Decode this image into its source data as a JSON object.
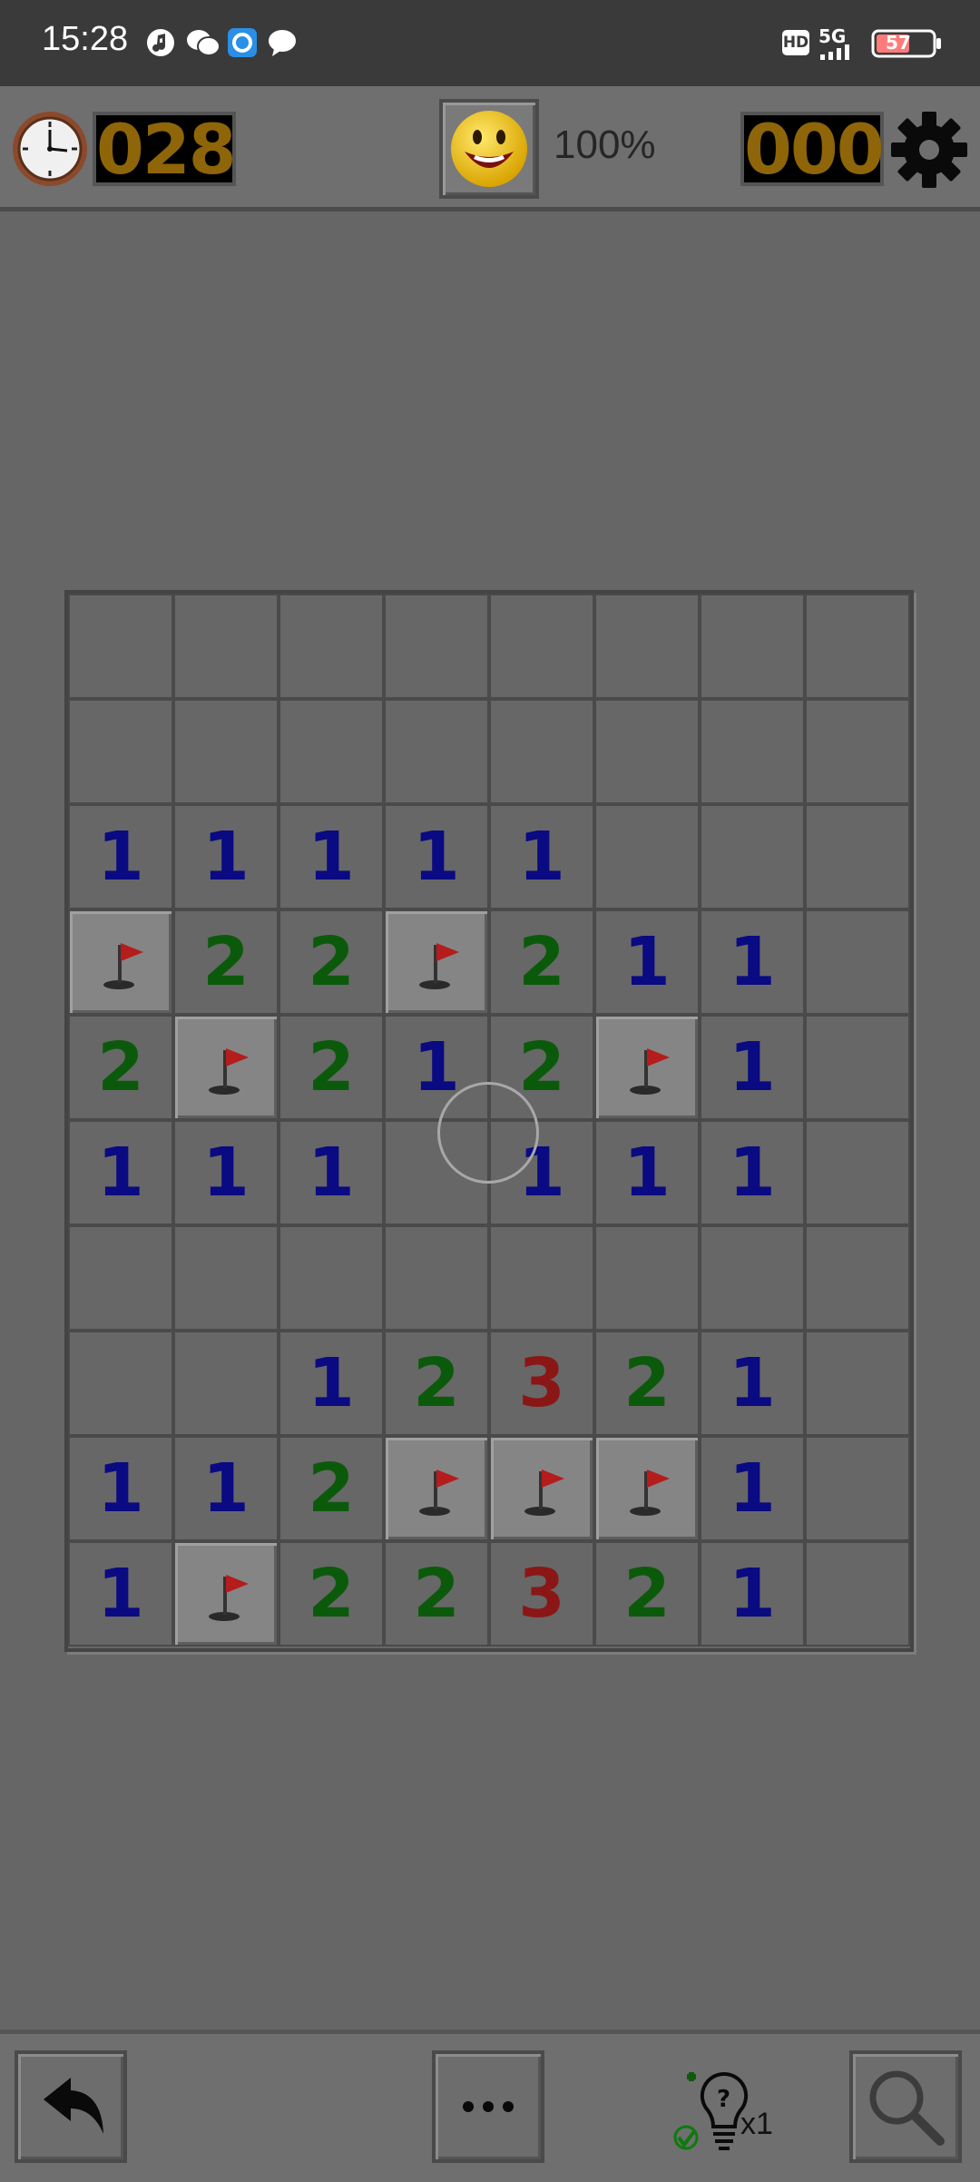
{
  "status_bar": {
    "time": "15:28",
    "network": "5G",
    "hd_badge": "HD",
    "battery_level": "57",
    "notification_icons": [
      "music-icon",
      "wechat-icon",
      "browser-icon",
      "message-icon"
    ]
  },
  "toolbar": {
    "timer_value": "028",
    "progress": "100%",
    "mine_counter": "000",
    "face": "smiley"
  },
  "board": {
    "rows": 10,
    "cols": 8,
    "grid": [
      [
        "",
        "",
        "",
        "",
        "",
        "",
        "",
        ""
      ],
      [
        "",
        "",
        "",
        "",
        "",
        "",
        "",
        ""
      ],
      [
        "1",
        "1",
        "1",
        "1",
        "1",
        "",
        "",
        ""
      ],
      [
        "F",
        "2",
        "2",
        "F",
        "2",
        "1",
        "1",
        ""
      ],
      [
        "2",
        "F",
        "2",
        "1",
        "2",
        "F",
        "1",
        ""
      ],
      [
        "1",
        "1",
        "1",
        "",
        "1",
        "1",
        "1",
        ""
      ],
      [
        "",
        "",
        "",
        "",
        "",
        "",
        "",
        ""
      ],
      [
        "",
        "",
        "1",
        "2",
        "3",
        "2",
        "1",
        ""
      ],
      [
        "1",
        "1",
        "2",
        "F",
        "F",
        "F",
        "1",
        ""
      ],
      [
        "1",
        "F",
        "2",
        "2",
        "3",
        "2",
        "1",
        ""
      ]
    ],
    "colors": {
      "1": "#0a0a82",
      "2": "#0b5a0b",
      "3": "#8a1616",
      "flag": "#b51c1c"
    }
  },
  "bottom_bar": {
    "hint_count": "x1",
    "buttons": [
      "undo-icon",
      "more-icon",
      "hint-icon",
      "magnifier-icon"
    ]
  }
}
